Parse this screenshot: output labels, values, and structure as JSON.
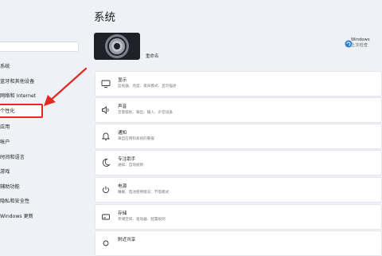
{
  "header": {
    "title": "系统",
    "pc_name": "重命名",
    "windows_update_title": "Windows",
    "windows_update_sub": "上次检查"
  },
  "nav": {
    "items": [
      {
        "label": "系统"
      },
      {
        "label": "蓝牙和其他设备"
      },
      {
        "label": "网络和 Internet"
      },
      {
        "label": "个性化"
      },
      {
        "label": "应用"
      },
      {
        "label": "帐户"
      },
      {
        "label": "时间和语言"
      },
      {
        "label": "游戏"
      },
      {
        "label": "辅助功能"
      },
      {
        "label": "隐私和安全性"
      },
      {
        "label": "Windows 更新"
      }
    ]
  },
  "cards": [
    {
      "title": "显示",
      "subtitle": "监视器、亮度、夜间模式、显示描述",
      "icon": "monitor-icon"
    },
    {
      "title": "声音",
      "subtitle": "音量级别、输出、输入、声音设备",
      "icon": "speaker-icon"
    },
    {
      "title": "通知",
      "subtitle": "来自应用和系统的警报",
      "icon": "bell-icon"
    },
    {
      "title": "专注助手",
      "subtitle": "通知、自动规则",
      "icon": "moon-icon"
    },
    {
      "title": "电源",
      "subtitle": "睡眠、电池使用情况、节电模式",
      "icon": "power-icon"
    },
    {
      "title": "存储",
      "subtitle": "存储空间、驱动器、配置规则",
      "icon": "storage-icon"
    },
    {
      "title": "附近共享",
      "subtitle": "",
      "icon": "share-icon"
    }
  ],
  "colors": {
    "highlight_box": "#e02b25",
    "arrow": "#e02b25",
    "update_icon": "#2a7fd4"
  }
}
